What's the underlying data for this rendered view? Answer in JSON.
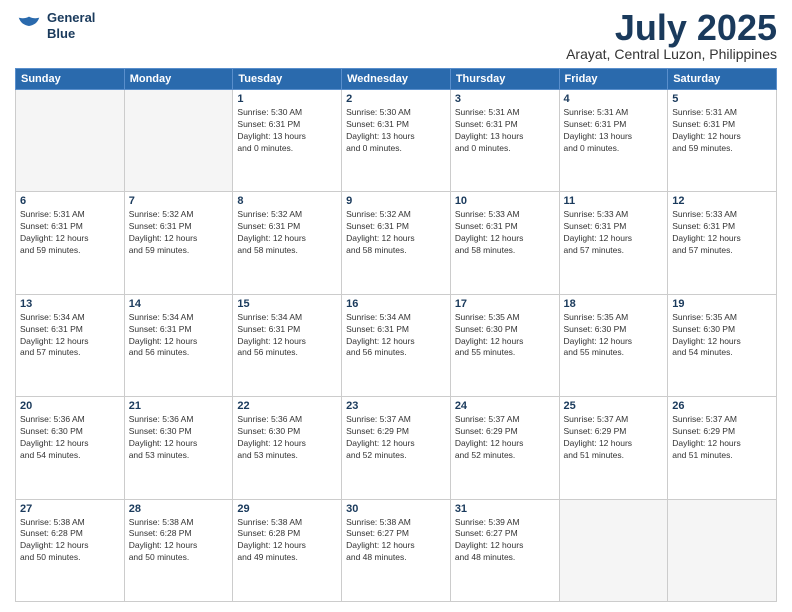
{
  "header": {
    "logo_line1": "General",
    "logo_line2": "Blue",
    "month_title": "July 2025",
    "location": "Arayat, Central Luzon, Philippines"
  },
  "days_of_week": [
    "Sunday",
    "Monday",
    "Tuesday",
    "Wednesday",
    "Thursday",
    "Friday",
    "Saturday"
  ],
  "weeks": [
    [
      {
        "day": "",
        "info": ""
      },
      {
        "day": "",
        "info": ""
      },
      {
        "day": "1",
        "info": "Sunrise: 5:30 AM\nSunset: 6:31 PM\nDaylight: 13 hours\nand 0 minutes."
      },
      {
        "day": "2",
        "info": "Sunrise: 5:30 AM\nSunset: 6:31 PM\nDaylight: 13 hours\nand 0 minutes."
      },
      {
        "day": "3",
        "info": "Sunrise: 5:31 AM\nSunset: 6:31 PM\nDaylight: 13 hours\nand 0 minutes."
      },
      {
        "day": "4",
        "info": "Sunrise: 5:31 AM\nSunset: 6:31 PM\nDaylight: 13 hours\nand 0 minutes."
      },
      {
        "day": "5",
        "info": "Sunrise: 5:31 AM\nSunset: 6:31 PM\nDaylight: 12 hours\nand 59 minutes."
      }
    ],
    [
      {
        "day": "6",
        "info": "Sunrise: 5:31 AM\nSunset: 6:31 PM\nDaylight: 12 hours\nand 59 minutes."
      },
      {
        "day": "7",
        "info": "Sunrise: 5:32 AM\nSunset: 6:31 PM\nDaylight: 12 hours\nand 59 minutes."
      },
      {
        "day": "8",
        "info": "Sunrise: 5:32 AM\nSunset: 6:31 PM\nDaylight: 12 hours\nand 58 minutes."
      },
      {
        "day": "9",
        "info": "Sunrise: 5:32 AM\nSunset: 6:31 PM\nDaylight: 12 hours\nand 58 minutes."
      },
      {
        "day": "10",
        "info": "Sunrise: 5:33 AM\nSunset: 6:31 PM\nDaylight: 12 hours\nand 58 minutes."
      },
      {
        "day": "11",
        "info": "Sunrise: 5:33 AM\nSunset: 6:31 PM\nDaylight: 12 hours\nand 57 minutes."
      },
      {
        "day": "12",
        "info": "Sunrise: 5:33 AM\nSunset: 6:31 PM\nDaylight: 12 hours\nand 57 minutes."
      }
    ],
    [
      {
        "day": "13",
        "info": "Sunrise: 5:34 AM\nSunset: 6:31 PM\nDaylight: 12 hours\nand 57 minutes."
      },
      {
        "day": "14",
        "info": "Sunrise: 5:34 AM\nSunset: 6:31 PM\nDaylight: 12 hours\nand 56 minutes."
      },
      {
        "day": "15",
        "info": "Sunrise: 5:34 AM\nSunset: 6:31 PM\nDaylight: 12 hours\nand 56 minutes."
      },
      {
        "day": "16",
        "info": "Sunrise: 5:34 AM\nSunset: 6:31 PM\nDaylight: 12 hours\nand 56 minutes."
      },
      {
        "day": "17",
        "info": "Sunrise: 5:35 AM\nSunset: 6:30 PM\nDaylight: 12 hours\nand 55 minutes."
      },
      {
        "day": "18",
        "info": "Sunrise: 5:35 AM\nSunset: 6:30 PM\nDaylight: 12 hours\nand 55 minutes."
      },
      {
        "day": "19",
        "info": "Sunrise: 5:35 AM\nSunset: 6:30 PM\nDaylight: 12 hours\nand 54 minutes."
      }
    ],
    [
      {
        "day": "20",
        "info": "Sunrise: 5:36 AM\nSunset: 6:30 PM\nDaylight: 12 hours\nand 54 minutes."
      },
      {
        "day": "21",
        "info": "Sunrise: 5:36 AM\nSunset: 6:30 PM\nDaylight: 12 hours\nand 53 minutes."
      },
      {
        "day": "22",
        "info": "Sunrise: 5:36 AM\nSunset: 6:30 PM\nDaylight: 12 hours\nand 53 minutes."
      },
      {
        "day": "23",
        "info": "Sunrise: 5:37 AM\nSunset: 6:29 PM\nDaylight: 12 hours\nand 52 minutes."
      },
      {
        "day": "24",
        "info": "Sunrise: 5:37 AM\nSunset: 6:29 PM\nDaylight: 12 hours\nand 52 minutes."
      },
      {
        "day": "25",
        "info": "Sunrise: 5:37 AM\nSunset: 6:29 PM\nDaylight: 12 hours\nand 51 minutes."
      },
      {
        "day": "26",
        "info": "Sunrise: 5:37 AM\nSunset: 6:29 PM\nDaylight: 12 hours\nand 51 minutes."
      }
    ],
    [
      {
        "day": "27",
        "info": "Sunrise: 5:38 AM\nSunset: 6:28 PM\nDaylight: 12 hours\nand 50 minutes."
      },
      {
        "day": "28",
        "info": "Sunrise: 5:38 AM\nSunset: 6:28 PM\nDaylight: 12 hours\nand 50 minutes."
      },
      {
        "day": "29",
        "info": "Sunrise: 5:38 AM\nSunset: 6:28 PM\nDaylight: 12 hours\nand 49 minutes."
      },
      {
        "day": "30",
        "info": "Sunrise: 5:38 AM\nSunset: 6:27 PM\nDaylight: 12 hours\nand 48 minutes."
      },
      {
        "day": "31",
        "info": "Sunrise: 5:39 AM\nSunset: 6:27 PM\nDaylight: 12 hours\nand 48 minutes."
      },
      {
        "day": "",
        "info": ""
      },
      {
        "day": "",
        "info": ""
      }
    ]
  ]
}
